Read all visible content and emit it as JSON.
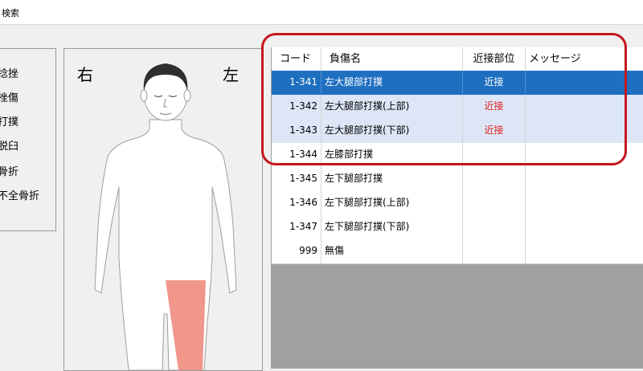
{
  "window": {
    "title": "検索"
  },
  "injury_types": [
    "捻挫",
    "挫傷",
    "打撲",
    "脱臼",
    "骨折",
    "不全骨折"
  ],
  "body_panel": {
    "right_label": "右",
    "left_label": "左"
  },
  "grid": {
    "headers": {
      "code": "コード",
      "name": "負傷名",
      "proximity": "近接部位",
      "message": "メッセージ"
    },
    "rows": [
      {
        "code": "1-341",
        "name": "左大腿部打撲",
        "proximity": "近接",
        "message": ""
      },
      {
        "code": "1-342",
        "name": "左大腿部打撲(上部)",
        "proximity": "近接",
        "message": ""
      },
      {
        "code": "1-343",
        "name": "左大腿部打撲(下部)",
        "proximity": "近接",
        "message": ""
      },
      {
        "code": "1-344",
        "name": "左膝部打撲",
        "proximity": "",
        "message": ""
      },
      {
        "code": "1-345",
        "name": "左下腿部打撲",
        "proximity": "",
        "message": ""
      },
      {
        "code": "1-346",
        "name": "左下腿部打撲(上部)",
        "proximity": "",
        "message": ""
      },
      {
        "code": "1-347",
        "name": "左下腿部打撲(下部)",
        "proximity": "",
        "message": ""
      },
      {
        "code": "999",
        "name": "無傷",
        "proximity": "",
        "message": ""
      }
    ],
    "selected_row": 1
  },
  "colors": {
    "selection": "#1f6fc0",
    "row_highlight": "#dde6f6",
    "proximity_text": "#e02020",
    "annotation_border": "#c4161c",
    "injury_area": "#f0968a"
  }
}
